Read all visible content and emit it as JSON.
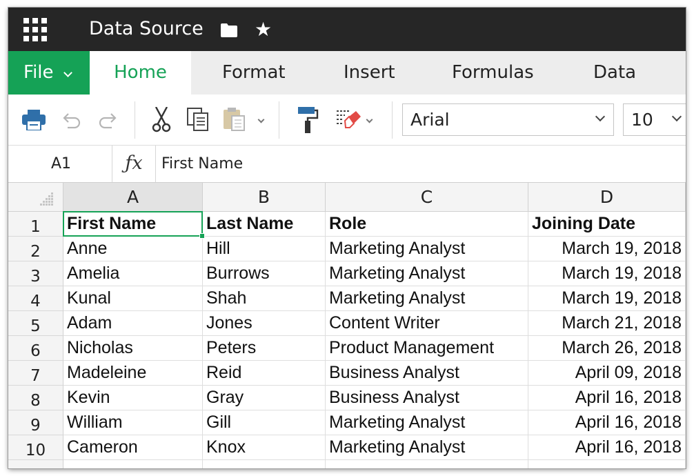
{
  "app": {
    "title": "Data Source",
    "icons": [
      "apps-grid-icon",
      "folder-icon",
      "star-icon"
    ]
  },
  "ribbon": {
    "file_label": "File",
    "tabs": [
      "Home",
      "Format",
      "Insert",
      "Formulas",
      "Data"
    ],
    "active_tab": "Home"
  },
  "toolbar": {
    "icons": [
      "print-icon",
      "undo-icon",
      "redo-icon",
      "cut-icon",
      "copy-icon",
      "paste-icon",
      "format-painter-icon",
      "clear-format-icon"
    ],
    "font": "Arial",
    "font_size": "10"
  },
  "formula_bar": {
    "cell_ref": "A1",
    "fx_label": "ƒx",
    "content": "First Name"
  },
  "sheet": {
    "columns": [
      "A",
      "B",
      "C",
      "D"
    ],
    "selected_column": "A",
    "row_numbers": [
      "1",
      "2",
      "3",
      "4",
      "5",
      "6",
      "7",
      "8",
      "9",
      "10"
    ],
    "rows": [
      [
        "First Name",
        "Last Name",
        "Role",
        "Joining Date"
      ],
      [
        "Anne",
        "Hill",
        "Marketing Analyst",
        "March 19, 2018"
      ],
      [
        "Amelia",
        "Burrows",
        "Marketing Analyst",
        "March 19, 2018"
      ],
      [
        "Kunal",
        "Shah",
        "Marketing Analyst",
        "March 19, 2018"
      ],
      [
        "Adam",
        "Jones",
        "Content Writer",
        "March 21, 2018"
      ],
      [
        "Nicholas",
        "Peters",
        "Product Management",
        "March 26, 2018"
      ],
      [
        "Madeleine",
        "Reid",
        "Business Analyst",
        "April 09, 2018"
      ],
      [
        "Kevin",
        "Gray",
        "Business Analyst",
        "April 16, 2018"
      ],
      [
        "William",
        "Gill",
        "Marketing Analyst",
        "April 16, 2018"
      ],
      [
        "Cameron",
        "Knox",
        "Marketing Analyst",
        "April 16, 2018"
      ]
    ],
    "selected_cell": "A1"
  },
  "colors": {
    "title_bar": "#262626",
    "accent_green": "#15a256",
    "ribbon_bg": "#ededed",
    "header_bg": "#f4f4f4"
  }
}
